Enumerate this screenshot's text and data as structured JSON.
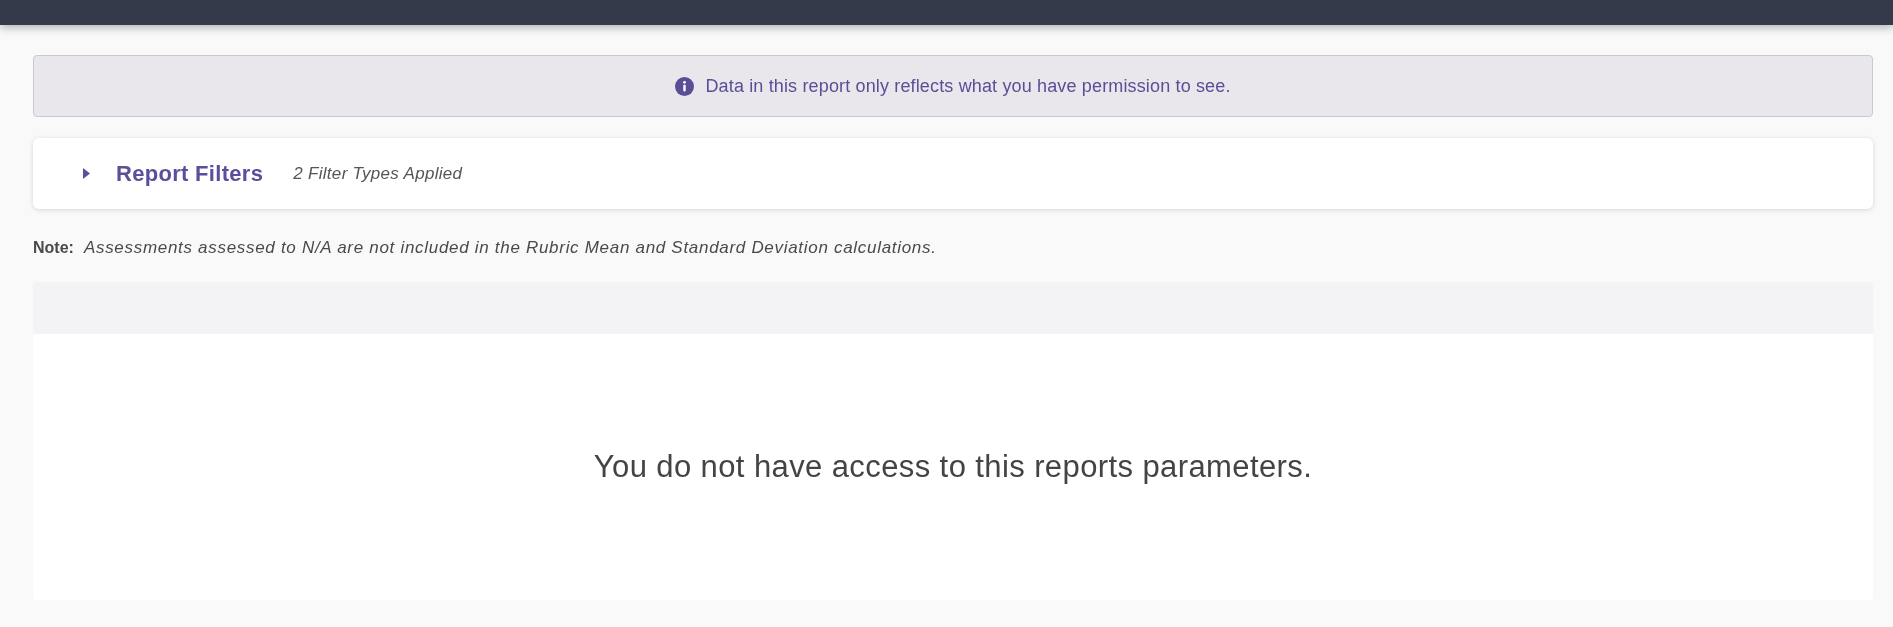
{
  "notice": {
    "text": "Data in this report only reflects what you have permission to see."
  },
  "filters": {
    "title": "Report Filters",
    "summary": "2 Filter Types Applied",
    "expanded": false
  },
  "note": {
    "label": "Note:",
    "text": "Assessments assessed to N/A are not included in the Rubric Mean and Standard Deviation calculations."
  },
  "report": {
    "message": "You do not have access to this reports parameters."
  }
}
